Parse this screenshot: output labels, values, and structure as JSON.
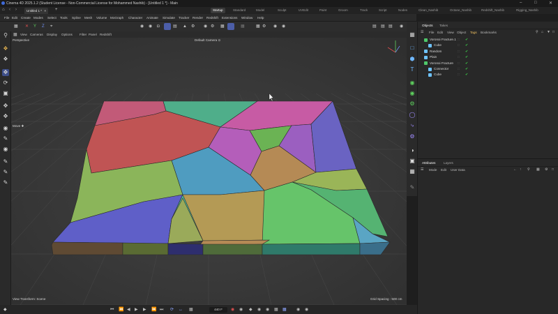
{
  "window": {
    "title": "Cinema 4D 2025.1.2 (Student License - Non-Commercial License for Mohammed Nashib) - [Untitled 1 *] - Main",
    "app_icon": "c4d-logo-icon"
  },
  "tabs": {
    "document": "Untitled 1 *",
    "layouts": [
      "Startup",
      "Standard",
      "Model",
      "Sculpt",
      "UVEdit",
      "Paint",
      "Groom",
      "Track",
      "Script",
      "Nodes",
      "Clean_Nashib",
      "Octane_Nashib",
      "Redshift_Nashib",
      "Rigging_Nashib"
    ],
    "active_layout": "Startup"
  },
  "menubar": [
    "File",
    "Edit",
    "Create",
    "Modes",
    "Select",
    "Tools",
    "Spline",
    "Mesh",
    "Volume",
    "MoGraph",
    "Character",
    "Animate",
    "Simulate",
    "Tracker",
    "Render",
    "Redshift",
    "Extensions",
    "Window",
    "Help"
  ],
  "viewport": {
    "menu": [
      "View",
      "Cameras",
      "Display",
      "Options",
      "Filter",
      "Panel",
      "Redshift"
    ],
    "view_name": "Perspective",
    "camera": "Default Camera ⊙",
    "tool_label": "Move ✚",
    "transform_label": "View Transform: Scene",
    "grid_spacing": "Grid Spacing : 500 cm",
    "background": "#3a3a3a"
  },
  "objects_panel": {
    "tabs": [
      "Objects",
      "Takes"
    ],
    "menu": [
      "File",
      "Edit",
      "View",
      "Object",
      "Tags",
      "Bookmarks"
    ],
    "rows": [
      {
        "name": "Voronoi Fracture.1",
        "indent": 1,
        "color": "#4ec86a"
      },
      {
        "name": "Cube",
        "indent": 2,
        "color": "#6ec3ff"
      },
      {
        "name": "Random",
        "indent": 1,
        "color": "#6ec3ff"
      },
      {
        "name": "Plain",
        "indent": 1,
        "color": "#6ec3ff"
      },
      {
        "name": "Voronoi Fracture",
        "indent": 1,
        "color": "#4ec86a"
      },
      {
        "name": "Connector",
        "indent": 2,
        "color": "#6ec3ff"
      },
      {
        "name": "Cube",
        "indent": 2,
        "color": "#6ec3ff"
      }
    ]
  },
  "attributes_panel": {
    "tabs": [
      "Attributes",
      "Layers"
    ],
    "menu": [
      "Mode",
      "Edit",
      "User Data"
    ]
  },
  "timeline": {
    "frame": "440 F"
  },
  "colors": {
    "accent": "#4c5ea8",
    "cells": [
      "#c25a78",
      "#4fae8a",
      "#c75ba4",
      "#c05454",
      "#b45eba",
      "#6bb354",
      "#9b5fc0",
      "#b58a55",
      "#6a63c2",
      "#4f9cc0",
      "#9ab558",
      "#55b372",
      "#8bb55a",
      "#b49a55",
      "#5f5fc8",
      "#4fba9a",
      "#66c46a",
      "#5aa5c4",
      "#9aaa5a",
      "#b58a55"
    ]
  }
}
